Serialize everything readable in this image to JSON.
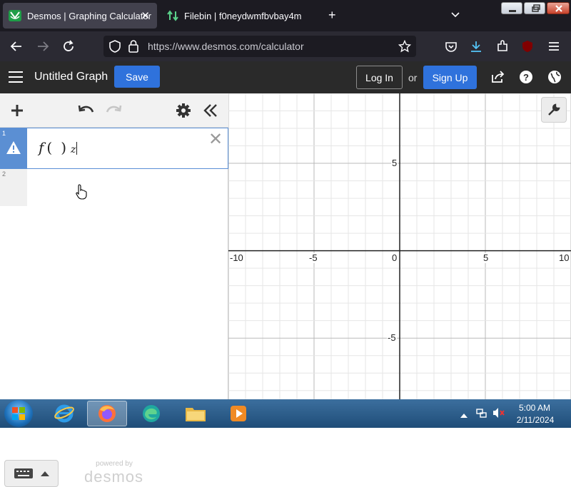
{
  "browser": {
    "tabs": [
      {
        "title": "Desmos | Graphing Calculator",
        "icon": "desmos-favicon",
        "active": true
      },
      {
        "title": "Filebin | f0neydwmfbvbay4m",
        "icon": "filebin-favicon",
        "active": false
      }
    ],
    "url": "https://www.desmos.com/calculator",
    "extension_badge": "1",
    "accent": "#42414d"
  },
  "desmos": {
    "graph_title": "Untitled Graph",
    "save_label": "Save",
    "login_label": "Log In",
    "or_label": "or",
    "signup_label": "Sign Up",
    "accent": "#2f72dc"
  },
  "expressions": [
    {
      "index": "1",
      "fn": "f",
      "open": "(",
      "close": ")",
      "var": "z",
      "status": "warning",
      "status_icon": "warning-triangle-icon"
    },
    {
      "index": "2"
    }
  ],
  "footer": {
    "powered_by": "powered by",
    "brand": "desmos"
  },
  "graph": {
    "x_ticks": [
      "-10",
      "-5",
      "0",
      "5",
      "10"
    ],
    "y_ticks": [
      "5",
      "-5"
    ],
    "x_range": [
      -10,
      10
    ],
    "y_range": [
      -8.5,
      9
    ],
    "grid": true
  },
  "taskbar": {
    "apps": [
      "internet-explorer",
      "firefox",
      "edge",
      "file-explorer",
      "media-player"
    ],
    "time": "5:00 AM",
    "date": "2/11/2024"
  }
}
